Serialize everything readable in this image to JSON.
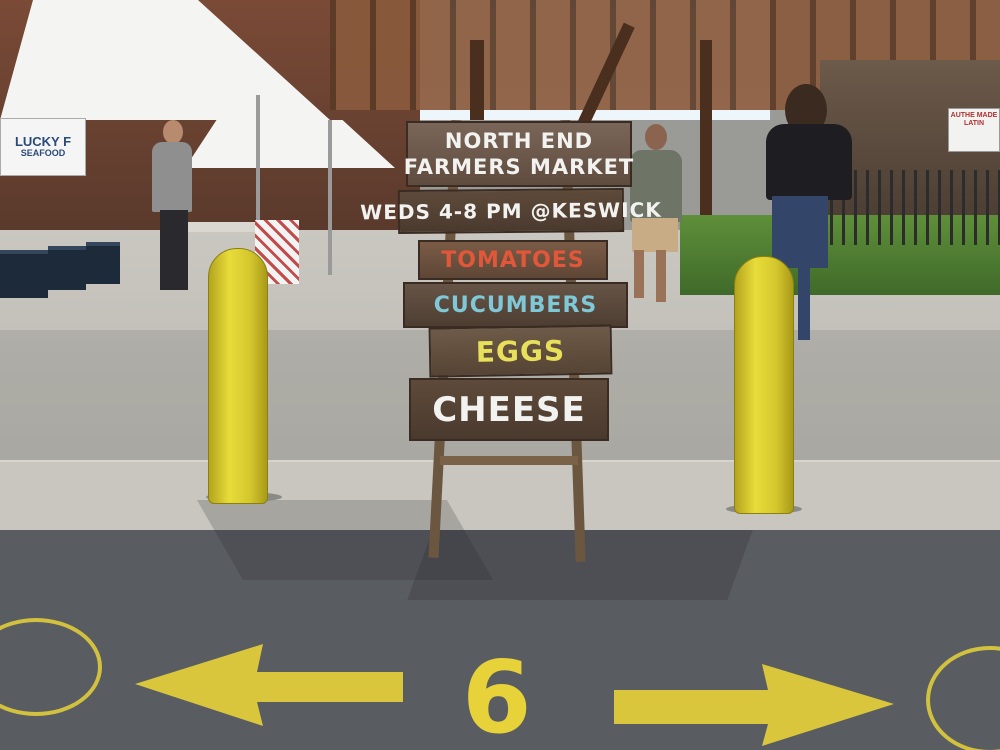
{
  "stall_banner": {
    "line1": "LUCKY F",
    "line2": "SEAFOOD"
  },
  "store_sign": {
    "text": "AUTHE MADE LATIN"
  },
  "signs": {
    "line1": "NORTH END",
    "line2": "FARMERS MARKET",
    "schedule": "WEDS 4-8 PM @KESWICK",
    "item1": "TOMATOES",
    "item2": "CUCUMBERS",
    "item3": "EGGS",
    "item4": "CHEESE"
  },
  "road": {
    "lane_number": "6"
  },
  "colors": {
    "bollard": "#dcd034",
    "road_paint": "#e8d23a",
    "tomatoes_text": "#e2573a",
    "cucumbers_text": "#7fc8d8",
    "eggs_text": "#e8e05a",
    "white_text": "#f2f2f0"
  }
}
